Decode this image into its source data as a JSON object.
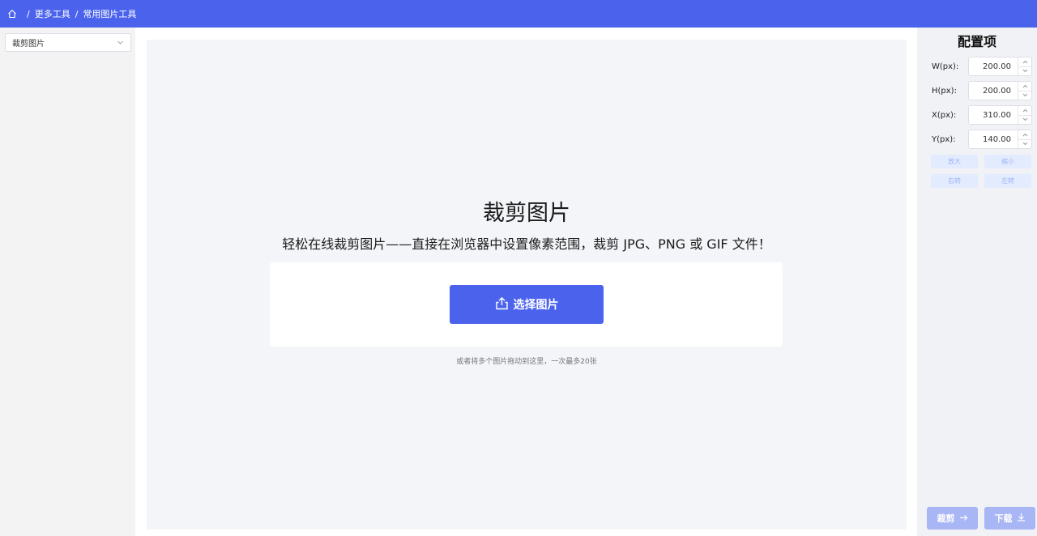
{
  "breadcrumb": {
    "home_icon": "home-icon",
    "separator": "/",
    "items": [
      "更多工具",
      "常用图片工具"
    ]
  },
  "tool_select": {
    "value": "裁剪图片",
    "icon": "chevron-down-icon"
  },
  "main": {
    "title": "裁剪图片",
    "subtitle": "轻松在线裁剪图片——直接在浏览器中设置像素范围，裁剪 JPG、PNG 或 GIF 文件！",
    "choose_button": "选择图片",
    "choose_icon": "upload-icon",
    "hint": "或者将多个图片拖动到这里，一次最多20张"
  },
  "config": {
    "title": "配置项",
    "fields": [
      {
        "label": "W(px):",
        "value": "200.00"
      },
      {
        "label": "H(px):",
        "value": "200.00"
      },
      {
        "label": "X(px):",
        "value": "310.00"
      },
      {
        "label": "Y(px):",
        "value": "140.00"
      }
    ],
    "buttons": {
      "zoom_in": "放大",
      "zoom_out": "缩小",
      "rotate_right": "右转",
      "rotate_left": "左转"
    },
    "crop_button": "裁剪",
    "download_button": "下载"
  },
  "colors": {
    "accent": "#4b63ec",
    "disabled_accent": "#a9b6f5",
    "mini_button_bg": "#e3ebff"
  }
}
